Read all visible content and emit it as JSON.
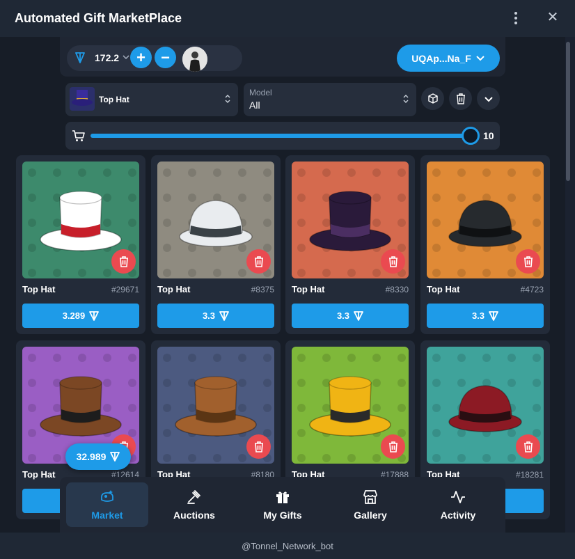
{
  "window": {
    "title": "Automated Gift MarketPlace"
  },
  "header": {
    "balance": "172.2",
    "wallet": "UQAp...Na_F"
  },
  "filters": {
    "gift_name": "Top Hat",
    "model_caption": "Model",
    "model_value": "All"
  },
  "slider": {
    "count": "10",
    "fill_fraction": 1.0
  },
  "cards": [
    {
      "name": "Top Hat",
      "num": "#29671",
      "price": "3.289",
      "bg": "#3d8a6c",
      "hat": "#ffffff",
      "band": "#c71f2a",
      "style": "top"
    },
    {
      "name": "Top Hat",
      "num": "#8375",
      "price": "3.3",
      "bg": "#8f8b80",
      "hat": "#e9ecef",
      "band": "#3a4146",
      "style": "bowler"
    },
    {
      "name": "Top Hat",
      "num": "#8330",
      "price": "3.3",
      "bg": "#d56a4e",
      "hat": "#2a1a3a",
      "band": "#4b2e62",
      "style": "top"
    },
    {
      "name": "Top Hat",
      "num": "#4723",
      "price": "3.3",
      "bg": "#e08a36",
      "hat": "#262a2e",
      "band": "#0f1113",
      "style": "bowler"
    },
    {
      "name": "Top Hat",
      "num": "#12614",
      "price": "",
      "bg": "#9a5ec4",
      "hat": "#7b4724",
      "band": "#1d1d1d",
      "style": "top"
    },
    {
      "name": "Top Hat",
      "num": "#8180",
      "price": "",
      "bg": "#4c5a80",
      "hat": "#a1602d",
      "band": "#5b3514",
      "style": "top"
    },
    {
      "name": "Top Hat",
      "num": "#17888",
      "price": "",
      "bg": "#7fb83a",
      "hat": "#f0b414",
      "band": "#2a2a2a",
      "style": "top"
    },
    {
      "name": "Top Hat",
      "num": "#18281",
      "price": "",
      "bg": "#3fa39b",
      "hat": "#8c1a24",
      "band": "#2a0e12",
      "style": "bowler"
    }
  ],
  "floating_total": "32.989",
  "nav": [
    {
      "label": "Market",
      "icon": "market-icon",
      "active": true
    },
    {
      "label": "Auctions",
      "icon": "gavel-icon",
      "active": false
    },
    {
      "label": "My Gifts",
      "icon": "gift-icon",
      "active": false
    },
    {
      "label": "Gallery",
      "icon": "store-icon",
      "active": false
    },
    {
      "label": "Activity",
      "icon": "activity-icon",
      "active": false
    }
  ],
  "footer": {
    "handle": "@Tonnel_Network_bot"
  },
  "colors": {
    "accent": "#1e9be8",
    "danger": "#ea4a50",
    "bg": "#171d27"
  }
}
